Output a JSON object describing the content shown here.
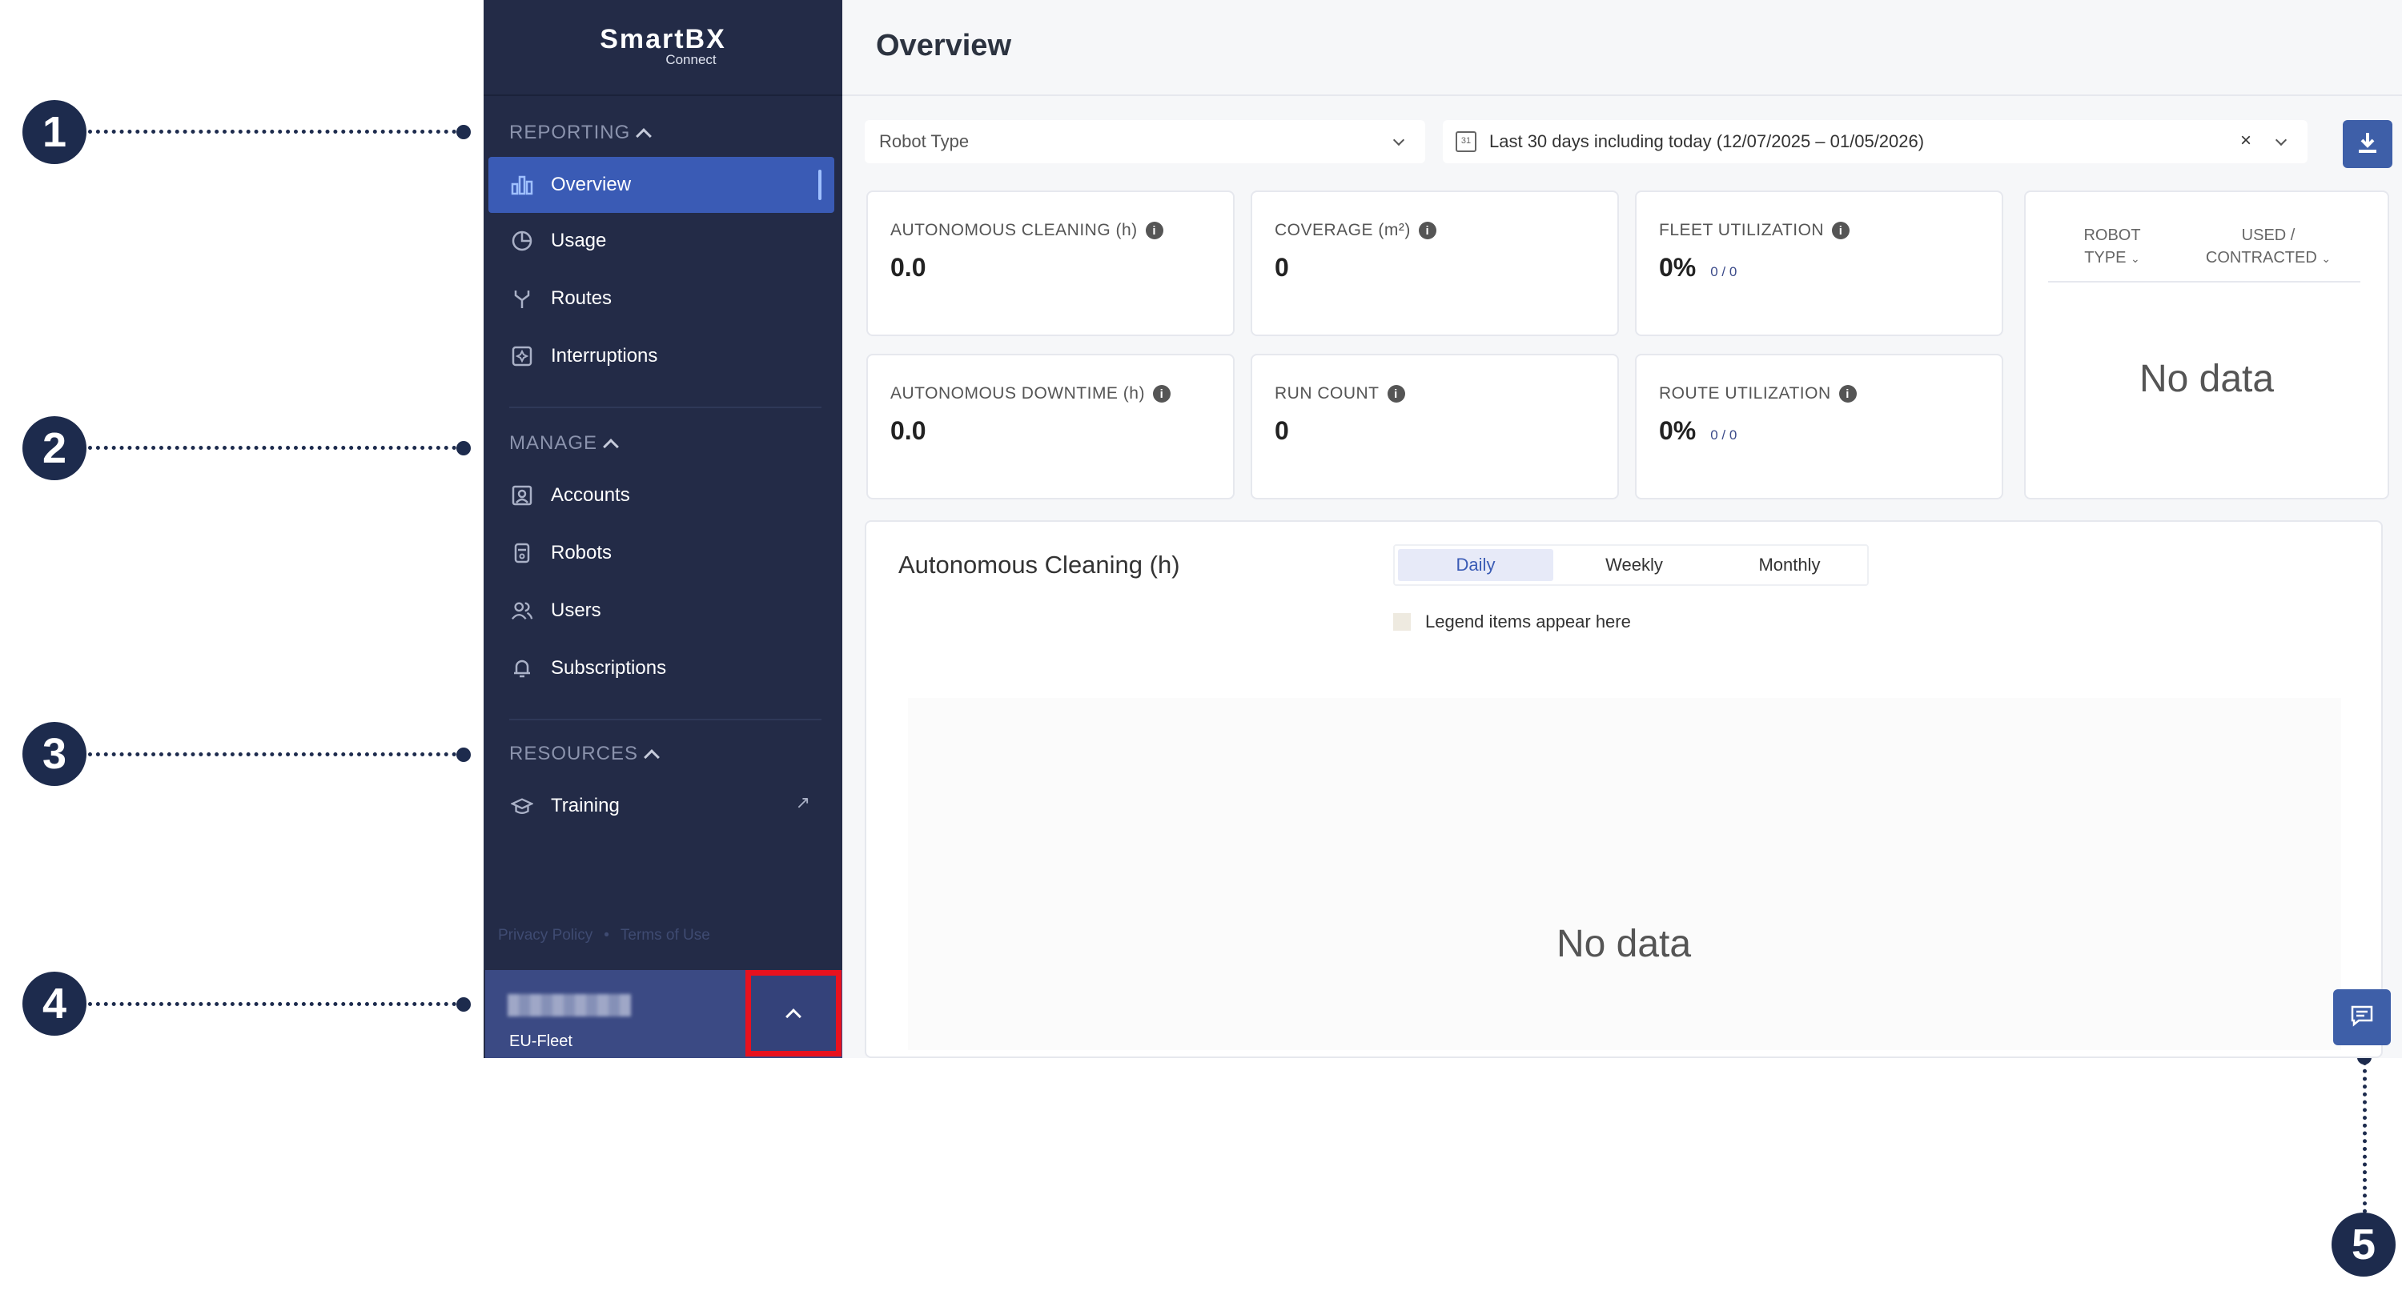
{
  "callouts": [
    "1",
    "2",
    "3",
    "4",
    "5"
  ],
  "brand": {
    "name": "SmartBX",
    "sub": "Connect"
  },
  "sidebar": {
    "sections": [
      {
        "title": "REPORTING",
        "items": [
          {
            "label": "Overview",
            "icon": "bar-chart-icon",
            "active": true
          },
          {
            "label": "Usage",
            "icon": "pie-chart-icon"
          },
          {
            "label": "Routes",
            "icon": "route-icon"
          },
          {
            "label": "Interruptions",
            "icon": "interruption-icon"
          }
        ]
      },
      {
        "title": "MANAGE",
        "items": [
          {
            "label": "Accounts",
            "icon": "account-icon"
          },
          {
            "label": "Robots",
            "icon": "robot-icon"
          },
          {
            "label": "Users",
            "icon": "users-icon"
          },
          {
            "label": "Subscriptions",
            "icon": "bell-icon"
          }
        ]
      },
      {
        "title": "RESOURCES",
        "items": [
          {
            "label": "Training",
            "icon": "graduation-cap-icon",
            "external": true
          }
        ]
      }
    ],
    "footer": {
      "privacy": "Privacy Policy",
      "separator": "•",
      "terms": "Terms of Use"
    },
    "account": {
      "fleet": "EU-Fleet"
    }
  },
  "header": {
    "title": "Overview"
  },
  "filters": {
    "robot_type_placeholder": "Robot Type",
    "date_range": "Last 30 days including today (12/07/2025 – 01/05/2026)",
    "clear": "×"
  },
  "metrics": [
    {
      "label": "AUTONOMOUS CLEANING (h)",
      "value": "0.0"
    },
    {
      "label": "COVERAGE (m²)",
      "value": "0"
    },
    {
      "label": "FLEET UTILIZATION",
      "value": "0%",
      "ratio": "0 / 0"
    },
    {
      "label": "AUTONOMOUS DOWNTIME (h)",
      "value": "0.0"
    },
    {
      "label": "RUN COUNT",
      "value": "0"
    },
    {
      "label": "ROUTE UTILIZATION",
      "value": "0%",
      "ratio": "0 / 0"
    }
  ],
  "robot_table": {
    "col1": "ROBOT TYPE",
    "col2": "USED / CONTRACTED",
    "empty": "No data"
  },
  "chart": {
    "title": "Autonomous Cleaning (h)",
    "tabs": [
      "Daily",
      "Weekly",
      "Monthly"
    ],
    "active_tab": "Daily",
    "legend": "Legend items appear here",
    "empty": "No data"
  },
  "colors": {
    "sidebar": "#232b47",
    "accent": "#3a5bb5",
    "highlight": "#e8111e",
    "callout": "#1d2b4d"
  }
}
